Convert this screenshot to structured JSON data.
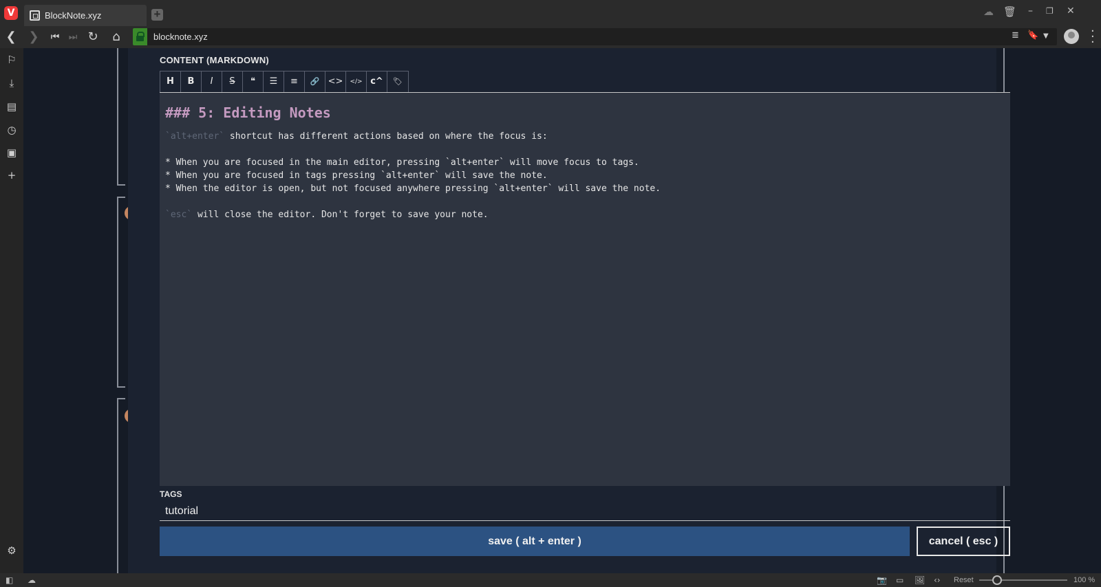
{
  "browser": {
    "tab_title": "BlockNote.xyz",
    "url": "blocknote.xyz",
    "logo": "V"
  },
  "editor": {
    "content_label": "CONTENT (MARKDOWN)",
    "toolbar": [
      {
        "name": "heading-button",
        "glyph": "H"
      },
      {
        "name": "bold-button",
        "glyph": "B"
      },
      {
        "name": "italic-button",
        "glyph": "I"
      },
      {
        "name": "strikethrough-button",
        "glyph": "S"
      },
      {
        "name": "quote-button",
        "glyph": "❝"
      },
      {
        "name": "bullet-list-button",
        "glyph": "☰"
      },
      {
        "name": "numbered-list-button",
        "glyph": "≡"
      },
      {
        "name": "link-button",
        "glyph": "🔗"
      },
      {
        "name": "code-button",
        "glyph": "<>"
      },
      {
        "name": "code-block-button",
        "glyph": "</>"
      },
      {
        "name": "superscript-button",
        "glyph": "c^"
      },
      {
        "name": "tag-button",
        "glyph": "🏷"
      }
    ],
    "heading": "### 5: Editing Notes",
    "intro_code": "`alt+enter`",
    "intro_rest": " shortcut has different actions based on where the focus is:",
    "bullets": [
      "* When you are focused in the main editor, pressing `alt+enter` will move focus to tags.",
      "* When you are focused in tags pressing `alt+enter` will save the note.",
      "* When the editor is open, but not focused anywhere pressing `alt+enter` will save the note."
    ],
    "esc_code": "`esc`",
    "esc_rest": " will close the editor. Don't forget to save your note.",
    "tags_label": "TAGS",
    "tags_value": "tutorial",
    "save_label": "save ( alt + enter )",
    "cancel_label": "cancel ( esc )"
  },
  "statusbar": {
    "reset_label": "Reset",
    "zoom": "100 %"
  },
  "colors": {
    "heading": "#c49ac0",
    "save_button": "#2c5282",
    "editor_bg": "#2e3440",
    "page_bg": "#151b26"
  }
}
